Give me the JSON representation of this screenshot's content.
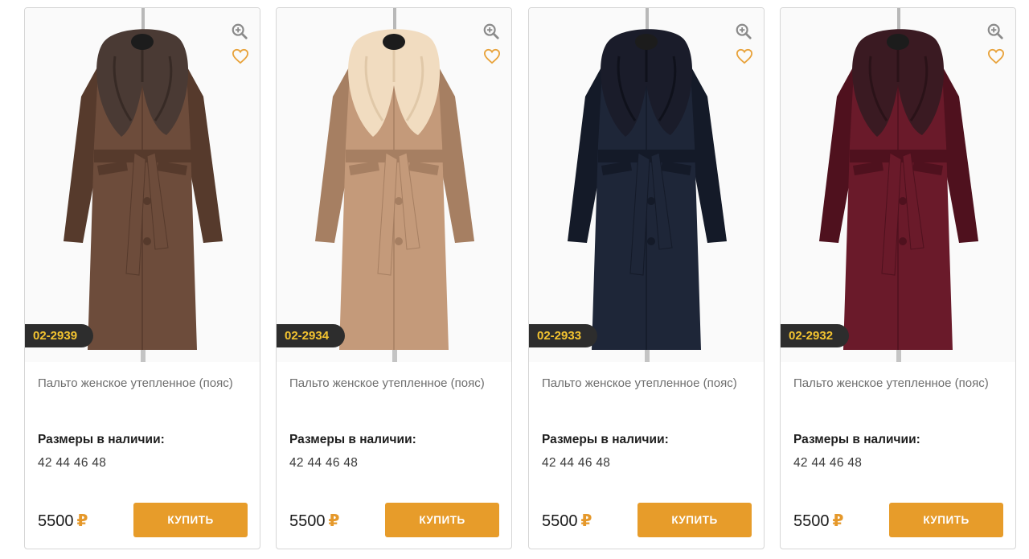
{
  "colors": {
    "accent": "#e79c2a",
    "sku_badge_bg": "#2d2d2d",
    "sku_badge_text": "#f4c430"
  },
  "products": [
    {
      "sku": "02-2939",
      "title": "Пальто женское утепленное (пояс)",
      "sizes_label": "Размеры в наличии:",
      "sizes": "42 44 46 48",
      "price": "5500",
      "currency": "₽",
      "buy_label": "КУПИТЬ",
      "coat_color": "#6d4c3b",
      "coat_shade": "#563a2c",
      "fur_color": "#4a3a34",
      "fur_shade": "#2f2420"
    },
    {
      "sku": "02-2934",
      "title": "Пальто женское утепленное (пояс)",
      "sizes_label": "Размеры в наличии:",
      "sizes": "42 44 46 48",
      "price": "5500",
      "currency": "₽",
      "buy_label": "КУПИТЬ",
      "coat_color": "#c49a7a",
      "coat_shade": "#a67f62",
      "fur_color": "#f1dcc0",
      "fur_shade": "#d9bf9e"
    },
    {
      "sku": "02-2933",
      "title": "Пальто женское утепленное (пояс)",
      "sizes_label": "Размеры в наличии:",
      "sizes": "42 44 46 48",
      "price": "5500",
      "currency": "₽",
      "buy_label": "КУПИТЬ",
      "coat_color": "#1e2638",
      "coat_shade": "#141a28",
      "fur_color": "#1a1c2a",
      "fur_shade": "#0c0d15"
    },
    {
      "sku": "02-2932",
      "title": "Пальто женское утепленное (пояс)",
      "sizes_label": "Размеры в наличии:",
      "sizes": "42 44 46 48",
      "price": "5500",
      "currency": "₽",
      "buy_label": "КУПИТЬ",
      "coat_color": "#6a1a2a",
      "coat_shade": "#4f111e",
      "fur_color": "#3a1a22",
      "fur_shade": "#240f14"
    }
  ],
  "icons": {
    "zoom": "zoom-in-icon",
    "favorite": "heart-icon"
  }
}
